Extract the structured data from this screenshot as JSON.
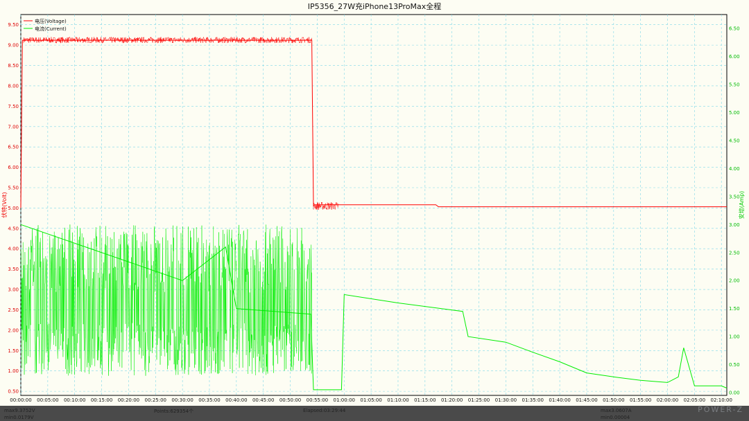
{
  "chart_data": {
    "type": "line",
    "title": "IP5356_27W充iPhone13ProMax全程",
    "y_left_label": "伏特(Volt)",
    "y_right_label": "安培(Amp)",
    "y_left_range": [
      0.4,
      9.75
    ],
    "y_right_range": [
      -0.05,
      6.75
    ],
    "y_left_ticks": [
      "0.50",
      "1.00",
      "1.50",
      "2.00",
      "2.50",
      "3.00",
      "3.50",
      "4.00",
      "4.50",
      "5.00",
      "5.50",
      "6.00",
      "6.50",
      "7.00",
      "7.50",
      "8.00",
      "8.50",
      "9.00",
      "9.50"
    ],
    "y_right_ticks": [
      "0.00",
      "0.50",
      "1.00",
      "1.50",
      "2.00",
      "2.50",
      "3.00",
      "3.50",
      "4.00",
      "4.50",
      "5.00",
      "5.50",
      "6.00",
      "6.50"
    ],
    "x_ticks": [
      "00:00:00",
      "00:05:00",
      "00:10:00",
      "00:15:00",
      "00:20:00",
      "00:25:00",
      "00:30:00",
      "00:35:00",
      "00:40:00",
      "00:45:00",
      "00:50:00",
      "00:55:00",
      "01:00:00",
      "01:05:00",
      "01:10:00",
      "01:15:00",
      "01:20:00",
      "01:25:00",
      "01:30:00",
      "01:35:00",
      "01:40:00",
      "01:45:00",
      "01:50:00",
      "01:55:00",
      "02:00:00",
      "02:05:00",
      "02:10:00"
    ],
    "x_range_minutes": [
      0,
      131
    ],
    "grid": true,
    "legend_position": "top-left",
    "series": [
      {
        "name": "电压(Voltage)",
        "axis": "left",
        "color": "#ff0000",
        "x_minutes": [
          0,
          0.3,
          0.5,
          54,
          54.3,
          54.5,
          59,
          77,
          77.5,
          131
        ],
        "values": [
          5.0,
          9.12,
          9.12,
          9.12,
          5.05,
          5.08,
          5.08,
          5.08,
          5.03,
          5.03
        ],
        "noise_band_x": [
          [
            0.5,
            54
          ],
          [
            54.3,
            59
          ]
        ],
        "noise_band_y": [
          [
            9.05,
            9.2
          ],
          [
            4.95,
            5.15
          ]
        ]
      },
      {
        "name": "电流(Current)",
        "axis": "right",
        "color": "#00ee00",
        "x_minutes": [
          0,
          30,
          38,
          40,
          53.8,
          54.3,
          59.5,
          60,
          70,
          82,
          83,
          90,
          95,
          100,
          105,
          110,
          115,
          120,
          122,
          123,
          125,
          130,
          131
        ],
        "values": [
          3.0,
          2.0,
          2.6,
          1.5,
          1.4,
          0.05,
          0.05,
          1.75,
          1.6,
          1.45,
          1.0,
          0.9,
          0.72,
          0.55,
          0.35,
          0.28,
          0.22,
          0.18,
          0.28,
          0.8,
          0.12,
          0.12,
          0.08
        ],
        "noise_band_x": [
          [
            0,
            54
          ]
        ],
        "noise_band_y": [
          [
            0.3,
            3.0
          ]
        ]
      }
    ]
  },
  "status": {
    "max_voltage": "max9.3752V",
    "min_voltage": "min0.0179V",
    "points": "Points:629354个",
    "elapsed": "Elapsed:03:29:44",
    "max_current": "max3.0607A",
    "min_current": "min0.00004"
  },
  "watermark": "POWER-Z"
}
